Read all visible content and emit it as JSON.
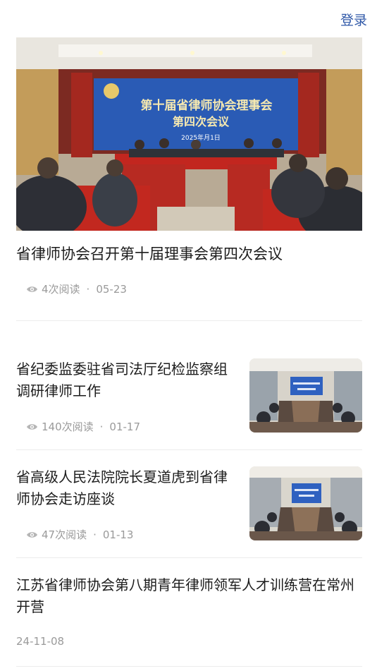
{
  "header": {
    "login_label": "登录"
  },
  "featured": {
    "title": "省律师协会召开第十届理事会第四次会议",
    "views": "4次阅读",
    "date": "05-23",
    "banner_text_line1": "第十届省律师协会理事会",
    "banner_text_line2": "第四次会议",
    "banner_date": "2025年月1日"
  },
  "articles": [
    {
      "title": "省纪委监委驻省司法厅纪检监察组调研律师工作",
      "views": "140次阅读",
      "date": "01-17"
    },
    {
      "title": "省高级人民法院院长夏道虎到省律师协会走访座谈",
      "views": "47次阅读",
      "date": "01-13"
    },
    {
      "title": "江苏省律师协会第八期青年律师领军人才训练营在常州开营",
      "date": "24-11-08"
    }
  ],
  "separator": "·",
  "colors": {
    "link": "#2f58a8",
    "meta": "#9a9a9a",
    "title": "#1c1c1c",
    "divider": "#ececec"
  }
}
